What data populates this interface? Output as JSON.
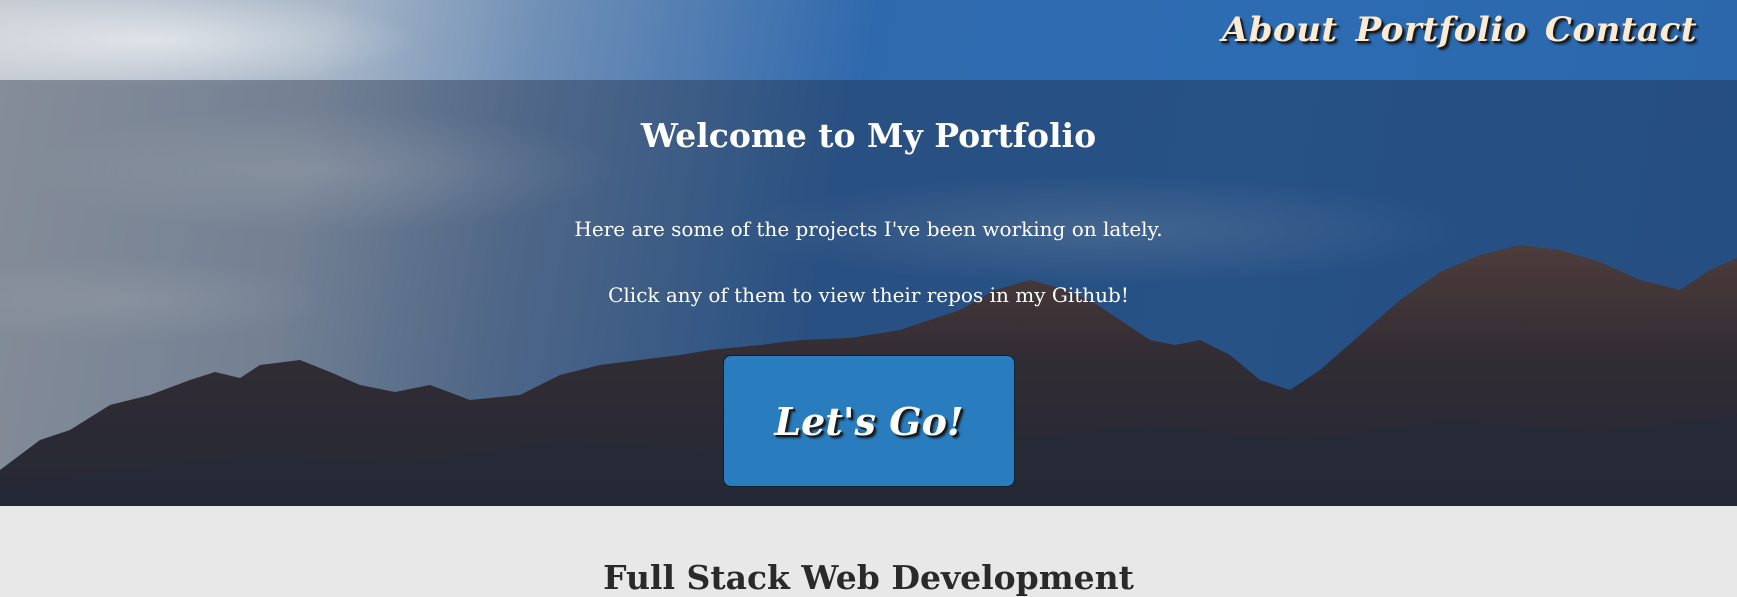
{
  "nav": {
    "links": [
      "About",
      "Portfolio",
      "Contact"
    ]
  },
  "hero": {
    "title": "Welcome to My Portfolio",
    "line1": "Here are some of the projects I've been working on lately.",
    "line2": "Click any of them to view their repos in my Github!",
    "cta_label": "Let's Go!"
  },
  "section": {
    "title": "Full Stack Web Development"
  },
  "colors": {
    "nav_text": "#fbead4",
    "cta_background": "#2984cb",
    "page_background": "#e8e8e8",
    "section_title": "#2a2a2a"
  }
}
